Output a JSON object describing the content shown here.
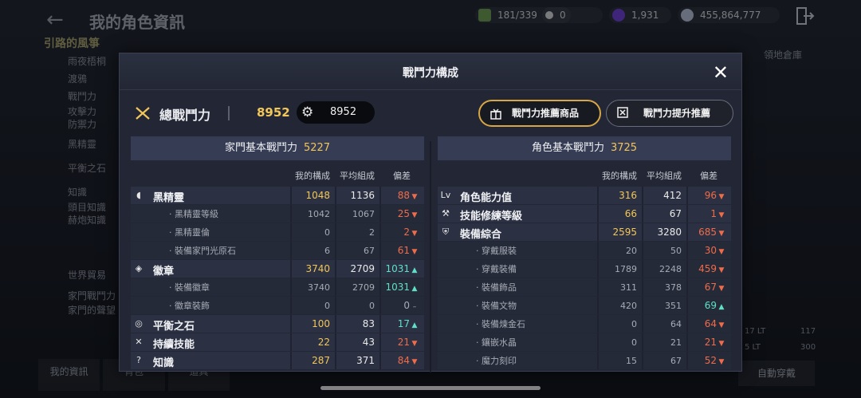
{
  "header": {
    "title": "我的角色資訊",
    "resources": [
      {
        "icon": "energy-icon",
        "value": "181/339",
        "color": "#8fd16a"
      },
      {
        "icon": "pearl-icon",
        "value": "0",
        "color": "#d9d9d9"
      },
      {
        "icon": "black-stone-icon",
        "value": "1,931",
        "color": "#8b5cf6"
      },
      {
        "icon": "silver-icon",
        "value": "455,864,777",
        "color": "#bfc7d6"
      }
    ]
  },
  "background": {
    "section_title": "引路的風箏",
    "items": [
      "雨夜梧桐",
      "渡鴉",
      "戰鬥力",
      "攻擊力",
      "防禦力",
      "黑精靈",
      "平衡之石",
      "知識",
      "頭目知識",
      "赫炮知識",
      "世界貿易",
      "家門戰鬥力",
      "家門的聲望"
    ],
    "tabs": [
      "我的資訊",
      "背包",
      "道具"
    ],
    "auto_button": "自動穿戴",
    "right_values": [
      "17 LT",
      "5 LT",
      "117",
      "300"
    ],
    "right_tab": "領地倉庫"
  },
  "modal": {
    "title": "戰鬥力構成",
    "total_label": "總戰鬥力",
    "total_value": "8952",
    "total_pill_value": "8952",
    "btn_recommend_goods": "戰鬥力推薦商品",
    "btn_improve": "戰鬥力提升推薦",
    "columns_header": {
      "mine": "我的構成",
      "avg": "平均組成",
      "diff": "偏差"
    },
    "family": {
      "title": "家門基本戰鬥力",
      "value": "5227",
      "rows": [
        {
          "type": "main",
          "icon": "black-spirit-icon",
          "name": "黑精靈",
          "mine": "1048",
          "avg": "1136",
          "diff": "88",
          "dir": "down"
        },
        {
          "type": "sub",
          "name": "· 黑精靈等級",
          "mine": "1042",
          "avg": "1067",
          "diff": "25",
          "dir": "down"
        },
        {
          "type": "sub",
          "name": "· 黑精靈倫",
          "mine": "0",
          "avg": "2",
          "diff": "2",
          "dir": "down"
        },
        {
          "type": "sub",
          "name": "· 裝備家門光原石",
          "mine": "6",
          "avg": "67",
          "diff": "61",
          "dir": "down"
        },
        {
          "type": "main",
          "icon": "emblem-icon",
          "name": "徽章",
          "mine": "3740",
          "avg": "2709",
          "diff": "1031",
          "dir": "up"
        },
        {
          "type": "sub",
          "name": "· 裝備徽章",
          "mine": "3740",
          "avg": "2709",
          "diff": "1031",
          "dir": "up"
        },
        {
          "type": "sub",
          "name": "· 徽章裝飾",
          "mine": "0",
          "avg": "0",
          "diff": "0",
          "dir": "none"
        },
        {
          "type": "main",
          "icon": "balance-stone-icon",
          "name": "平衡之石",
          "mine": "100",
          "avg": "83",
          "diff": "17",
          "dir": "up"
        },
        {
          "type": "main",
          "icon": "skill-icon",
          "name": "持續技能",
          "mine": "22",
          "avg": "43",
          "diff": "21",
          "dir": "down"
        },
        {
          "type": "main",
          "icon": "knowledge-icon",
          "name": "知識",
          "mine": "287",
          "avg": "371",
          "diff": "84",
          "dir": "down"
        }
      ]
    },
    "character": {
      "title": "角色基本戰鬥力",
      "value": "3725",
      "rows": [
        {
          "type": "main",
          "icon": "level-icon",
          "name": "角色能力值",
          "mine": "316",
          "avg": "412",
          "diff": "96",
          "dir": "down"
        },
        {
          "type": "main",
          "icon": "crossed-tools-icon",
          "name": "技能修練等級",
          "mine": "66",
          "avg": "67",
          "diff": "1",
          "dir": "down"
        },
        {
          "type": "main",
          "icon": "armor-icon",
          "name": "裝備綜合",
          "mine": "2595",
          "avg": "3280",
          "diff": "685",
          "dir": "down"
        },
        {
          "type": "sub",
          "name": "· 穿戴服裝",
          "mine": "20",
          "avg": "50",
          "diff": "30",
          "dir": "down"
        },
        {
          "type": "sub",
          "name": "· 穿戴裝備",
          "mine": "1789",
          "avg": "2248",
          "diff": "459",
          "dir": "down"
        },
        {
          "type": "sub",
          "name": "· 裝備飾品",
          "mine": "311",
          "avg": "378",
          "diff": "67",
          "dir": "down"
        },
        {
          "type": "sub",
          "name": "· 裝備文物",
          "mine": "420",
          "avg": "351",
          "diff": "69",
          "dir": "up"
        },
        {
          "type": "sub",
          "name": "· 裝備煉金石",
          "mine": "0",
          "avg": "64",
          "diff": "64",
          "dir": "down"
        },
        {
          "type": "sub",
          "name": "· 鑲嵌水晶",
          "mine": "0",
          "avg": "21",
          "diff": "21",
          "dir": "down"
        },
        {
          "type": "sub",
          "name": "· 魔力刻印",
          "mine": "15",
          "avg": "67",
          "diff": "52",
          "dir": "down"
        }
      ]
    }
  }
}
